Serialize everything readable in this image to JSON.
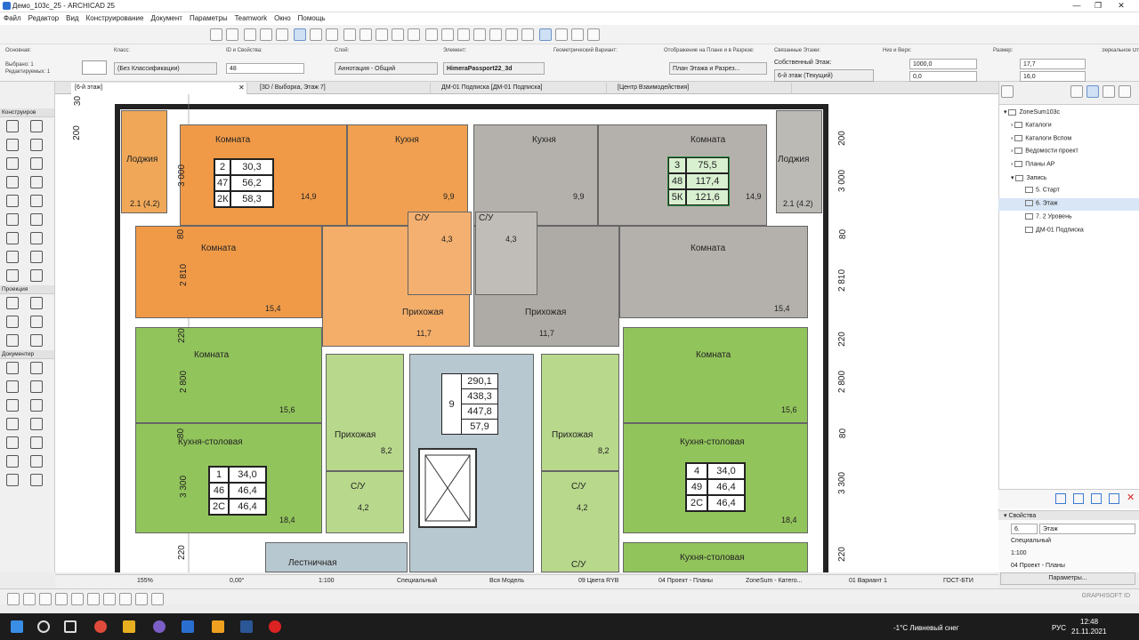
{
  "app": {
    "title": "Демо_103с_25 - ARCHICAD 25"
  },
  "menu": [
    "Файл",
    "Редактор",
    "Вид",
    "Конструирование",
    "Документ",
    "Параметры",
    "Teamwork",
    "Окно",
    "Помощь"
  ],
  "infobox": {
    "osnovnaya_label": "Основная:",
    "selected": "Выбрано: 1",
    "editable": "Редактируемых: 1",
    "class_label": "Класс:",
    "class_value": "(Без Классификации)",
    "id_label": "ID и Свойства:",
    "id_value": "48",
    "layer_label": "Слой:",
    "layer_value": "Аннотация - Общий",
    "element_label": "Элемент:",
    "element_value": "HimeraPassport22_3d",
    "geom_label": "Геометрический Вариант:",
    "display_label": "Отображение на Плане и в Разрезе:",
    "display_value": "План Этажа и Разрез...",
    "linked_label": "Связанные Этажи:",
    "own_floor_label": "Собственный Этаж:",
    "own_floor_value": "6-й этаж (Текущий)",
    "bottom_top_label": "Низ и Верх:",
    "bottom_value": "1000,0",
    "top_value": "0,0",
    "size_label": "Размер:",
    "size_w": "17,7",
    "size_h": "16,0",
    "mirror_label": "Зеркальное Отображение"
  },
  "tabs": [
    "[6-й этаж]",
    "[3D / Выборка, Этаж 7]",
    "ДМ-01 Подписка [ДМ-01 Подписка]",
    "[Центр Взаимодействия]"
  ],
  "toolbox": {
    "sections": [
      "Конструиров",
      "Проекция",
      "Документир"
    ]
  },
  "plan": {
    "rooms": [
      {
        "name": "Лоджия",
        "area": "2.1 (4.2)"
      },
      {
        "name": "Комната",
        "area": "14,9"
      },
      {
        "name": "Кухня",
        "area": "9,9"
      },
      {
        "name": "Кухня",
        "area": "9,9"
      },
      {
        "name": "Комната",
        "area": "14,9"
      },
      {
        "name": "Лоджия",
        "area": "2.1 (4.2)"
      },
      {
        "name": "С/У",
        "area": "4,3"
      },
      {
        "name": "С/У",
        "area": "4,3"
      },
      {
        "name": "Комната",
        "area": "15,4"
      },
      {
        "name": "Прихожая",
        "area": "11,7"
      },
      {
        "name": "Прихожая",
        "area": "11,7"
      },
      {
        "name": "Комната",
        "area": "15,4"
      },
      {
        "name": "Комната",
        "area": "15,6"
      },
      {
        "name": "Комната",
        "area": "15,6"
      },
      {
        "name": "Прихожая",
        "area": "8,2"
      },
      {
        "name": "Прихожая",
        "area": "8,2"
      },
      {
        "name": "Кухня-столовая",
        "area": "18,4"
      },
      {
        "name": "Кухня-столовая",
        "area": "18,4"
      },
      {
        "name": "С/У",
        "area": "4,2"
      },
      {
        "name": "С/У",
        "area": "4,2"
      },
      {
        "name": "Лестничная",
        "area": ""
      },
      {
        "name": "Кухня-столовая",
        "area": ""
      },
      {
        "name": "С/У",
        "area": ""
      }
    ],
    "zone_tables": [
      {
        "cells": [
          "2",
          "30,3",
          "47",
          "56,2",
          "2К",
          "58,3"
        ]
      },
      {
        "cells": [
          "3",
          "75,5",
          "48",
          "117,4",
          "5К",
          "121,6"
        ]
      },
      {
        "cells": [
          "1",
          "34,0",
          "46",
          "46,4",
          "2С",
          "46,4"
        ]
      },
      {
        "cells": [
          "4",
          "34,0",
          "49",
          "46,4",
          "2С",
          "46,4"
        ]
      }
    ],
    "summary_table": {
      "num": "9",
      "values": [
        "290,1",
        "438,3",
        "447,8",
        "57,9"
      ]
    },
    "dims_left": [
      "200",
      "3 000",
      "80",
      "2 810",
      "220",
      "2 800",
      "80",
      "3 300",
      "220",
      "30"
    ],
    "dims_right": [
      "200",
      "3 000",
      "80",
      "2 810",
      "220",
      "2 800",
      "80",
      "3 300",
      "220"
    ]
  },
  "navigator": {
    "root": "ZoneSum103с",
    "items": [
      "Каталоги",
      "Каталоги Вспом",
      "Ведомости проект",
      "Планы АР",
      "Запись",
      "5. Старт",
      "6. Этаж",
      "7. 2 Уровень",
      "ДМ-01 Подписка"
    ]
  },
  "props": {
    "title": "Свойства",
    "num": "6.",
    "name": "Этаж",
    "type": "Специальный",
    "scale": "1:100",
    "layers": "04 Проект - Планы",
    "button": "Параметры..."
  },
  "status": {
    "zoom": "155%",
    "angle": "0,00°",
    "scale": "1:100",
    "pen": "Специальный",
    "model": "Вся Модель",
    "colors": "09 Цвета RYB",
    "layers": "04 Проект - Планы",
    "zonesum": "ZoneSum - Катего...",
    "variant": "01 Вариант 1",
    "standard": "ГОСТ-БТИ"
  },
  "brand": "GRAPHISOFT ID",
  "taskbar": {
    "weather": "-1°C  Ливневый снег",
    "lang": "РУС",
    "time": "12:48",
    "date": "21.11.2021"
  },
  "colors": {
    "orange": "#f0a050",
    "green": "#9cc86a",
    "gray": "#b4b1ac",
    "lightgreen": "#c8df9c",
    "blue": "#b8c8d0"
  }
}
